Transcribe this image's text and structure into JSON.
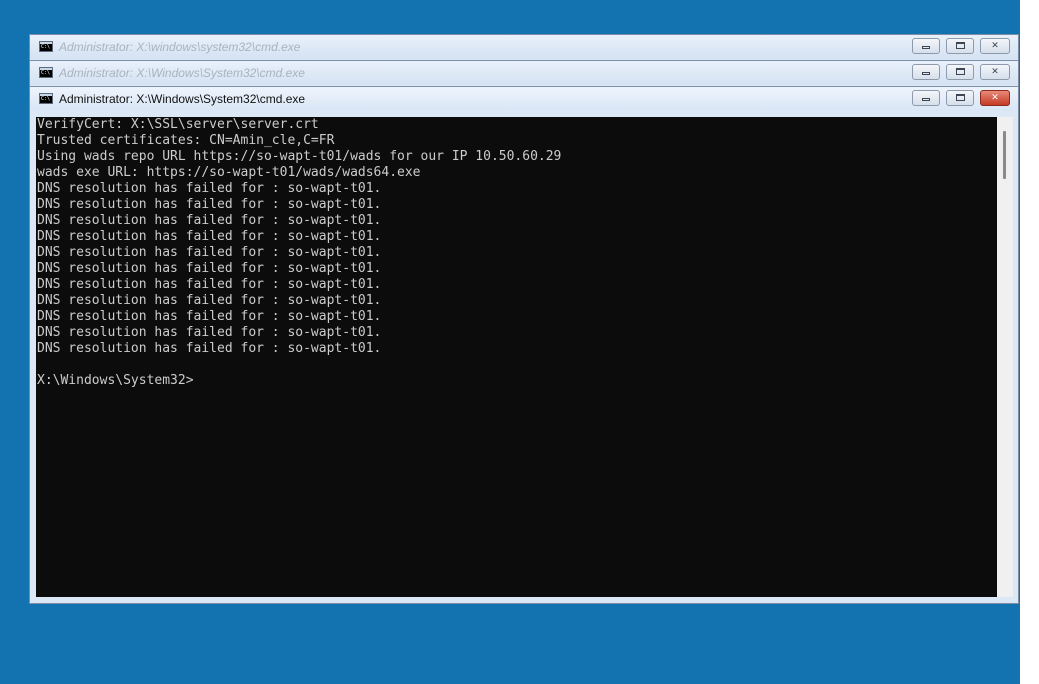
{
  "windows": {
    "back1": {
      "title": "Administrator: X:\\windows\\system32\\cmd.exe",
      "icon": "cmd-icon"
    },
    "back2": {
      "title": "Administrator: X:\\Windows\\System32\\cmd.exe",
      "icon": "cmd-icon"
    },
    "main": {
      "title": "Administrator: X:\\Windows\\System32\\cmd.exe",
      "icon": "cmd-icon",
      "close_glyph": "✕",
      "console": {
        "lines": [
          "VerifyCert: X:\\SSL\\server\\server.crt",
          "Trusted certificates: CN=Amin_cle,C=FR",
          "Using wads repo URL https://so-wapt-t01/wads for our IP 10.50.60.29",
          "wads exe URL: https://so-wapt-t01/wads/wads64.exe",
          "DNS resolution has failed for : so-wapt-t01.",
          "DNS resolution has failed for : so-wapt-t01.",
          "DNS resolution has failed for : so-wapt-t01.",
          "DNS resolution has failed for : so-wapt-t01.",
          "DNS resolution has failed for : so-wapt-t01.",
          "DNS resolution has failed for : so-wapt-t01.",
          "DNS resolution has failed for : so-wapt-t01.",
          "DNS resolution has failed for : so-wapt-t01.",
          "DNS resolution has failed for : so-wapt-t01.",
          "DNS resolution has failed for : so-wapt-t01.",
          "DNS resolution has failed for : so-wapt-t01.",
          "",
          "X:\\Windows\\System32>"
        ]
      }
    }
  },
  "colors": {
    "desktop": "#1372b0",
    "console_bg": "#0c0c0c",
    "console_fg": "#cccccc",
    "close_button": "#c43b26"
  }
}
